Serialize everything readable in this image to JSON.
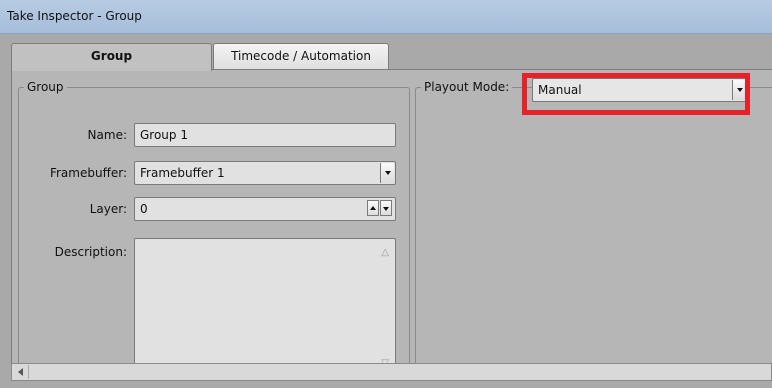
{
  "window": {
    "title": "Take Inspector - Group"
  },
  "tabs": [
    {
      "label": "Group",
      "active": true
    },
    {
      "label": "Timecode / Automation",
      "active": false
    }
  ],
  "group_section": {
    "legend": "Group",
    "name": {
      "label": "Name:",
      "value": "Group 1"
    },
    "framebuffer": {
      "label": "Framebuffer:",
      "value": "Framebuffer 1"
    },
    "layer": {
      "label": "Layer:",
      "value": "0"
    },
    "description": {
      "label": "Description:",
      "value": ""
    }
  },
  "playout_section": {
    "legend": "Playout Mode:",
    "mode": {
      "value": "Manual"
    }
  },
  "colors": {
    "highlight": "#e5222a",
    "titlebar": "#b7cbe3",
    "panel": "#b6b6b6"
  },
  "icons": {
    "scroll_left": "arrow-left-icon",
    "dropdown": "chevron-down-icon",
    "spin_up": "spin-up-icon",
    "spin_down": "spin-down-icon"
  }
}
